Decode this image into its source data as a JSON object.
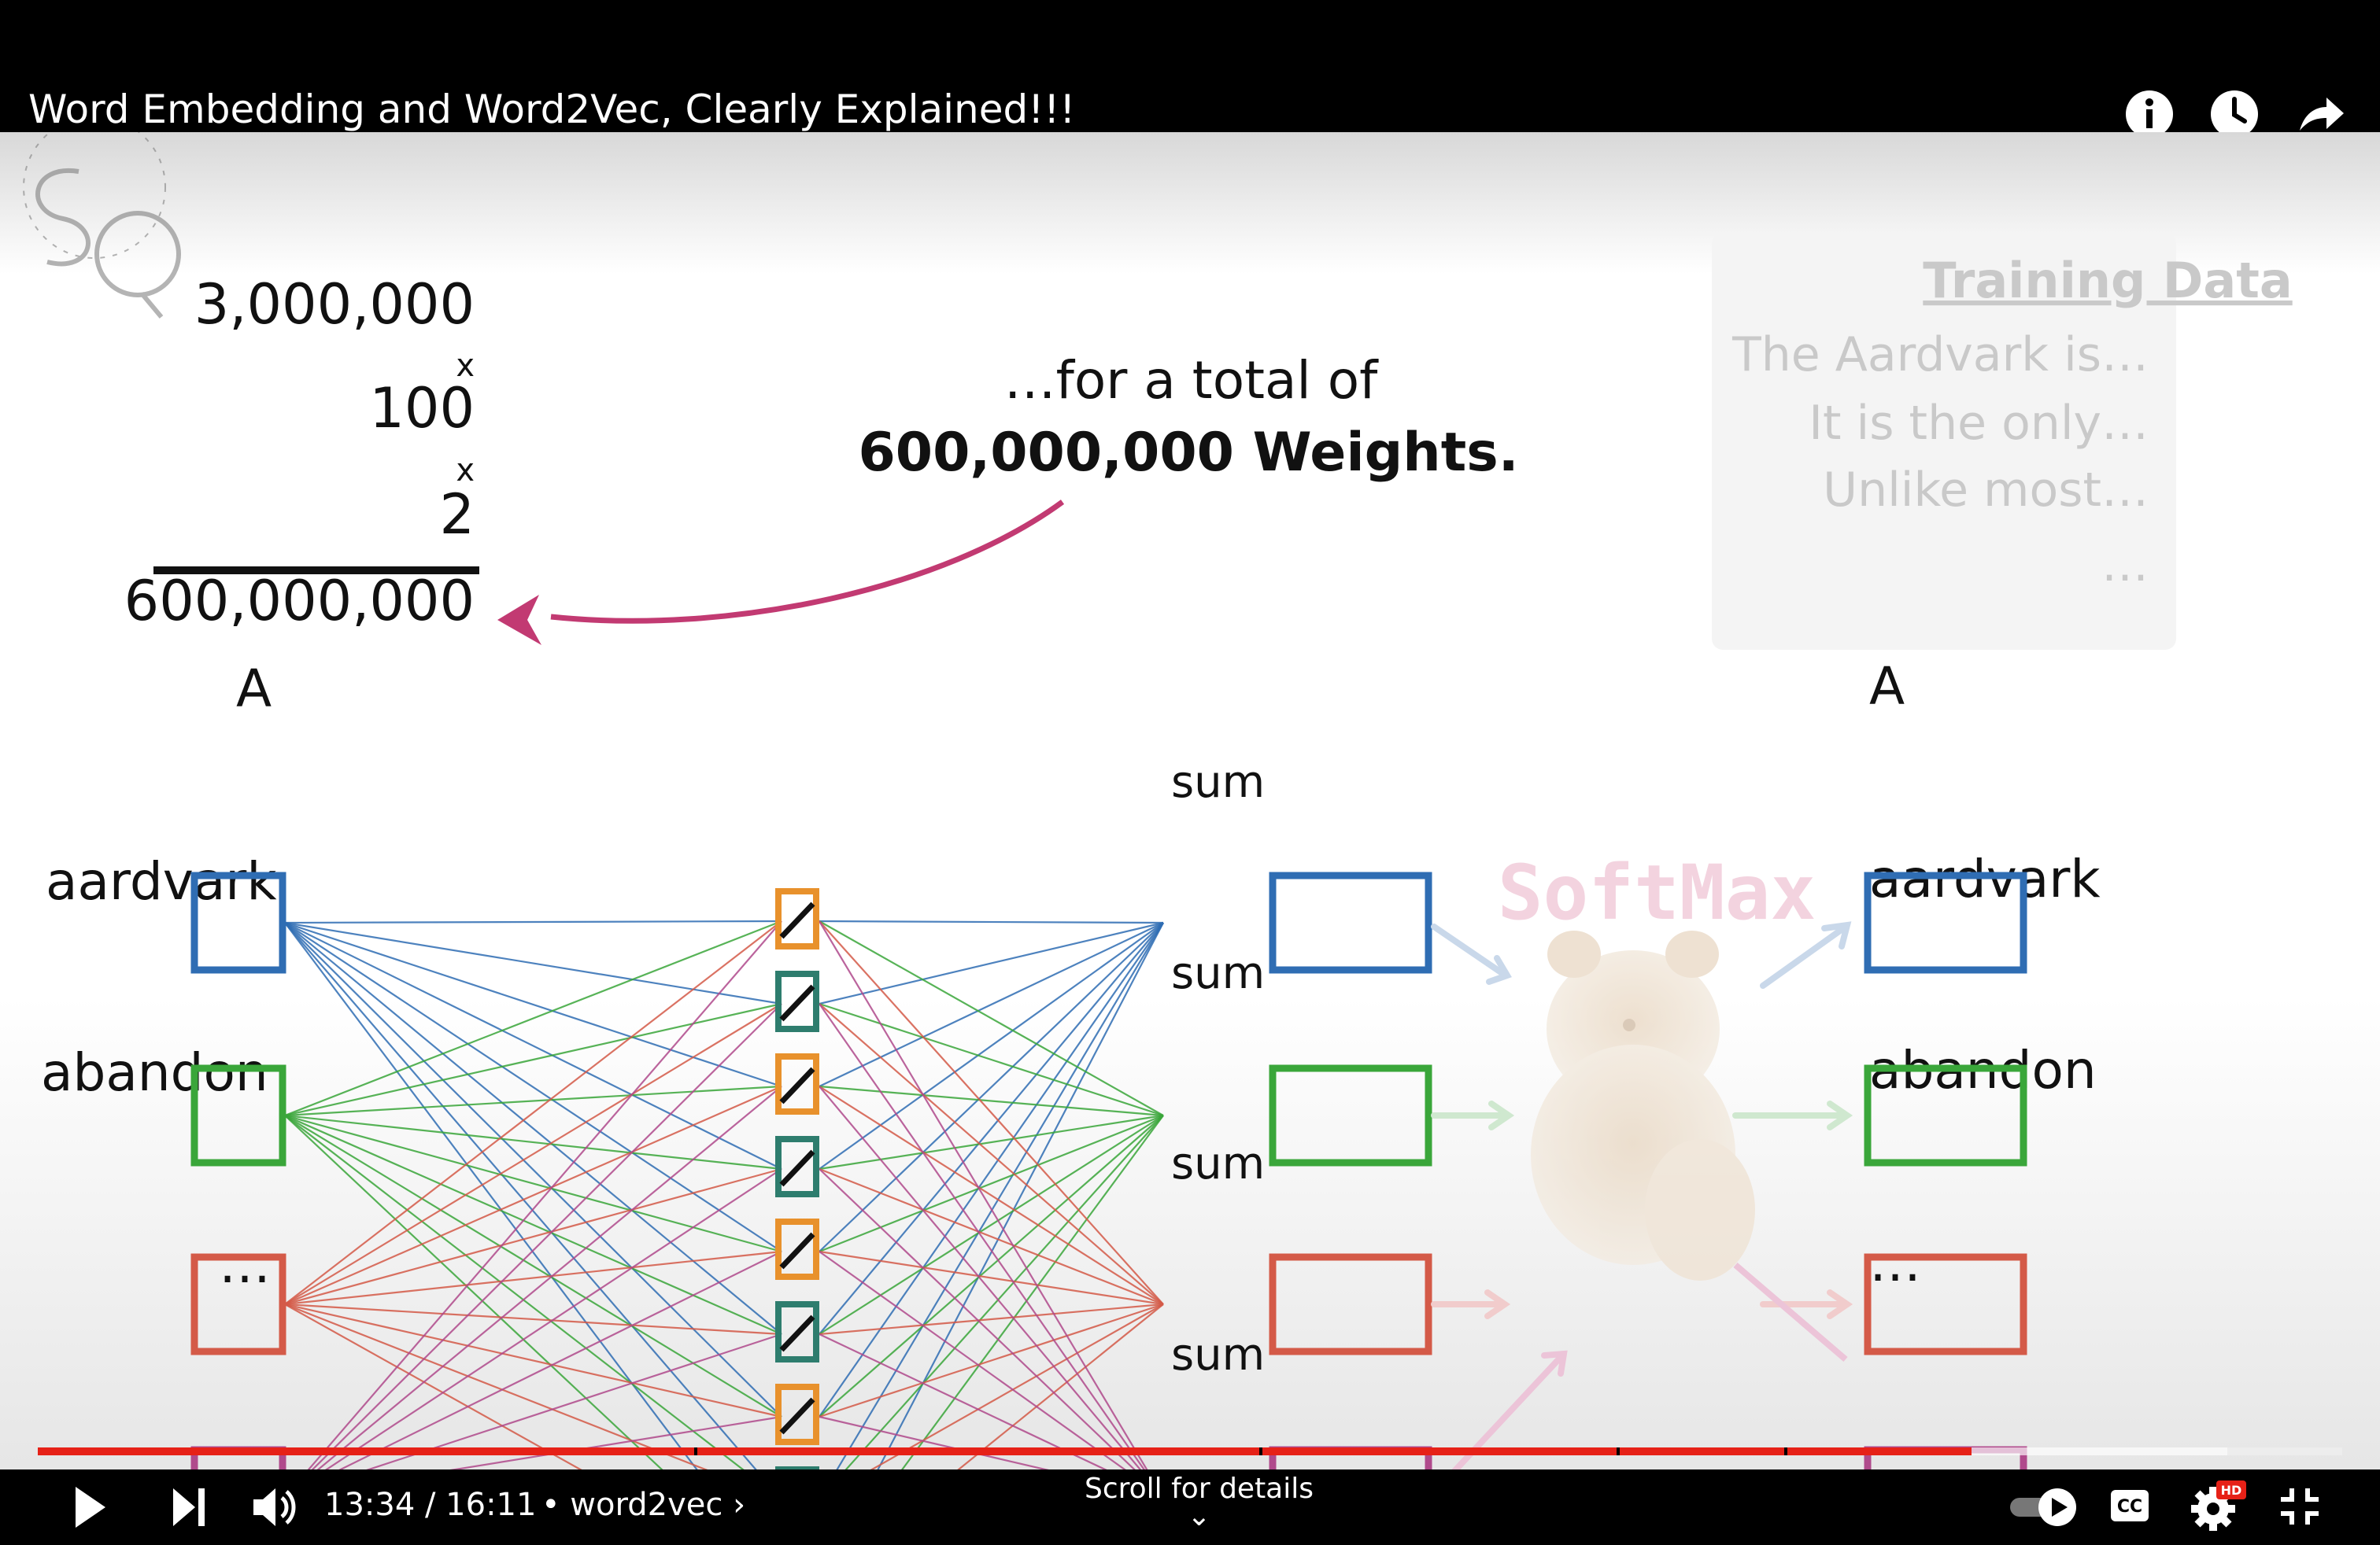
{
  "header": {
    "title": "Word Embedding and Word2Vec, Clearly Explained!!!",
    "icons": [
      "info-icon",
      "clock-icon",
      "share-icon"
    ]
  },
  "slide": {
    "multiplication": {
      "factor1": "3,000,000",
      "op1": "x",
      "factor2": "100",
      "op2": "x",
      "factor3": "2",
      "product": "600,000,000"
    },
    "callout": {
      "line1": "…for a total of",
      "line2": "600,000,000 Weights."
    },
    "training_data": {
      "title": "Training Data",
      "lines": [
        "The Aardvark is…",
        "It is the only…",
        "Unlike most…",
        "…"
      ]
    },
    "input_labels": [
      "A",
      "aardvark",
      "abandon",
      "…"
    ],
    "sum_labels": [
      "sum",
      "sum",
      "sum",
      "sum"
    ],
    "softmax_label": "SoftMax",
    "output_labels": [
      "A",
      "aardvark",
      "abandon",
      "…"
    ],
    "node_colors": [
      "#2f6db3",
      "#3aa63a",
      "#d45a48",
      "#b04a8c"
    ],
    "weight_colors": [
      "#e8912c",
      "#2e7d6e"
    ]
  },
  "player": {
    "time": "13:34 / 16:11",
    "chapter": "• word2vec",
    "scroll_hint": "Scroll for details",
    "progress_fraction": 0.839,
    "buffered_fraction": 0.95,
    "accent": "#e62117"
  }
}
